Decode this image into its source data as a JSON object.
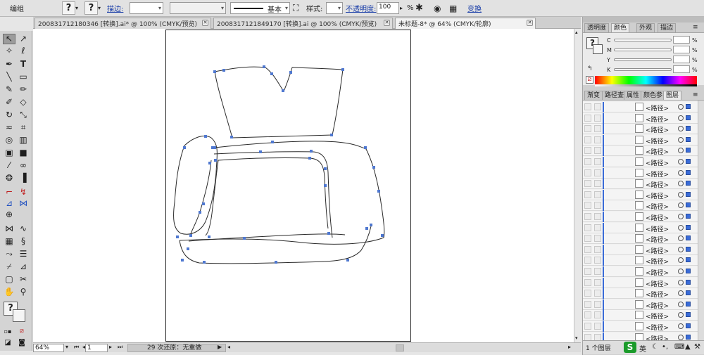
{
  "control_bar": {
    "object_type": "编组",
    "stroke_label": "描边:",
    "stroke_profile": "基本",
    "style_label": "样式:",
    "opacity_label": "不透明度:",
    "opacity_value": "100",
    "opacity_unit": "%",
    "transform_label": "变换",
    "help_glyph": "?"
  },
  "document_tabs": [
    {
      "label": "20083171218034​6 [转换].ai* @ 100% (CMYK/预览)",
      "active": false
    },
    {
      "label": "200831712184917​0 [转换].ai @ 100% (CMYK/预览)",
      "active": false
    },
    {
      "label": "未标题-8* @ 64% (CMYK/轮廓)",
      "active": true
    }
  ],
  "status_bar": {
    "zoom": "64%",
    "page": "1",
    "undo_status": "29 次还原：无重做"
  },
  "color_panel": {
    "tabs": [
      "透明度",
      "颜色",
      "外观",
      "描边"
    ],
    "active_tab": "颜色",
    "channels": [
      {
        "label": "C",
        "unit": "%"
      },
      {
        "label": "M",
        "unit": "%"
      },
      {
        "label": "Y",
        "unit": "%"
      },
      {
        "label": "K",
        "unit": "%"
      }
    ]
  },
  "layers_panel": {
    "tabs": [
      "渐变",
      "路径查",
      "属性",
      "颜色参",
      "图层"
    ],
    "active_tab": "图层",
    "item_label": "<路径>",
    "rows": 22,
    "footer_count": "1 个图层"
  },
  "colors": {
    "anchor_blue": "#4f78d0",
    "path_stroke": "#2a2a2a",
    "selection_blue": "#3a6cd8"
  }
}
